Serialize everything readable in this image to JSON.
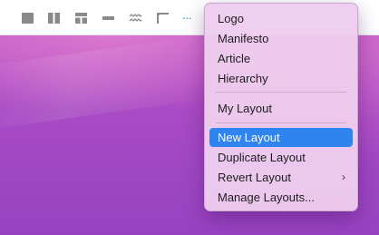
{
  "toolbar": {
    "icons": [
      "single-column-layout-icon",
      "two-column-layout-icon",
      "header-columns-layout-icon",
      "collapse-row-icon",
      "wave-pattern-icon",
      "corner-shape-icon",
      "more-options-icon"
    ],
    "more_glyph": "···"
  },
  "menu": {
    "items": [
      {
        "label": "Logo"
      },
      {
        "label": "Manifesto"
      },
      {
        "label": "Article"
      },
      {
        "label": "Hierarchy"
      },
      {
        "label": "My Layout"
      },
      {
        "label": "New Layout",
        "selected": true
      },
      {
        "label": "Duplicate Layout"
      },
      {
        "label": "Revert Layout",
        "submenu": true
      },
      {
        "label": "Manage Layouts..."
      }
    ],
    "submenu_glyph": "›"
  },
  "colors": {
    "selection": "#2f84f0",
    "accent_more": "#3a8ee6",
    "toolbar_icon": "#8a8a8a",
    "desktop": "#9a3bc0"
  }
}
